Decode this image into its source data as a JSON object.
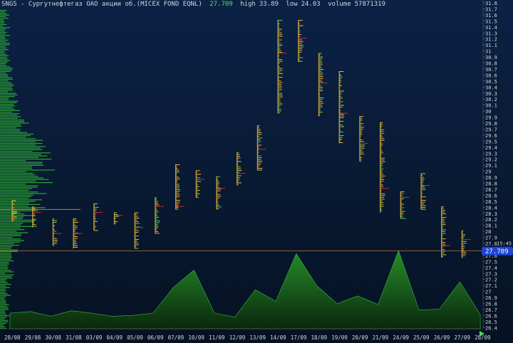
{
  "header": {
    "instrument": "SNGS - Сургутнефтегаз ОАО акции об.(MICEX FOND EQNL)",
    "last": "27.709",
    "high_label": "high",
    "high": "33.89",
    "low_label": "low",
    "low": "24.03",
    "volume_label": "volume",
    "volume": "57871319"
  },
  "price_axis": {
    "labels": [
      "31.8",
      "31.7",
      "31.6",
      "31.5",
      "31.4",
      "31.3",
      "31.2",
      "31.1",
      "31",
      "30.9",
      "30.8",
      "30.7",
      "30.6",
      "30.5",
      "30.4",
      "30.3",
      "30.2",
      "30.1",
      "30",
      "29.9",
      "29.8",
      "29.7",
      "29.6",
      "29.5",
      "29.4",
      "29.3",
      "29.2",
      "29.1",
      "29",
      "28.9",
      "28.8",
      "28.7",
      "28.6",
      "28.5",
      "28.4",
      "28.3",
      "28.2",
      "28.1",
      "28",
      "27.9",
      "27.8",
      "27.7",
      "27.6",
      "27.5",
      "27.4",
      "27.3",
      "27.2",
      "27.1",
      "27",
      "26.9",
      "26.8",
      "26.7",
      "26.6",
      "26.5",
      "26.4"
    ],
    "current_price_tag": "27.709",
    "time_tag": "15:45"
  },
  "colors": {
    "background_top": "#0b2245",
    "background_bottom": "#061223",
    "volume_fill": "#1c7a1c",
    "profile_bar": "#2fbf2f",
    "price_line": "#d78a3a",
    "price_tag": "#1d44d8",
    "poc": "#d22626",
    "axis_text": "#d6d6d6"
  },
  "chart_data": {
    "type": "area",
    "title": "",
    "x": [
      "28/08",
      "29/08",
      "30/08",
      "31/08",
      "03/09",
      "04/09",
      "05/09",
      "06/09",
      "07/09",
      "10/09",
      "11/09",
      "12/09",
      "13/09",
      "14/09",
      "17/09",
      "18/09",
      "19/09",
      "20/09",
      "21/09",
      "24/09",
      "25/09",
      "26/09",
      "27/09",
      "28/09"
    ],
    "session_ranges": [
      {
        "date": "28/08",
        "low": 28.2,
        "high": 28.55,
        "poc": 28.4
      },
      {
        "date": "29/08",
        "low": 28.1,
        "high": 28.45,
        "poc": 28.35
      },
      {
        "date": "30/08",
        "low": 27.8,
        "high": 28.25,
        "poc": 28.0
      },
      {
        "date": "31/08",
        "low": 27.75,
        "high": 28.25,
        "poc": 28.0
      },
      {
        "date": "03/09",
        "low": 28.05,
        "high": 28.5,
        "poc": 28.35
      },
      {
        "date": "04/09",
        "low": 28.15,
        "high": 28.35,
        "poc": 28.3
      },
      {
        "date": "05/09",
        "low": 27.75,
        "high": 28.35,
        "poc": 28.1
      },
      {
        "date": "06/09",
        "low": 28.0,
        "high": 28.6,
        "poc": 28.45
      },
      {
        "date": "07/09",
        "low": 28.4,
        "high": 29.15,
        "poc": 28.45
      },
      {
        "date": "10/09",
        "low": 28.6,
        "high": 29.05,
        "poc": 28.9
      },
      {
        "date": "11/09",
        "low": 28.4,
        "high": 28.95,
        "poc": 28.75
      },
      {
        "date": "12/09",
        "low": 28.8,
        "high": 29.35,
        "poc": 29.0
      },
      {
        "date": "13/09",
        "low": 29.05,
        "high": 29.8,
        "poc": 29.4
      },
      {
        "date": "14/09",
        "low": 30.0,
        "high": 31.55,
        "poc": 31.0
      },
      {
        "date": "17/09",
        "low": 30.85,
        "high": 31.55,
        "poc": 31.25
      },
      {
        "date": "18/09",
        "low": 29.95,
        "high": 31.0,
        "poc": 30.5
      },
      {
        "date": "19/09",
        "low": 29.5,
        "high": 30.7,
        "poc": 30.0
      },
      {
        "date": "20/09",
        "low": 29.2,
        "high": 29.95,
        "poc": 29.5
      },
      {
        "date": "21/09",
        "low": 28.35,
        "high": 29.85,
        "poc": 28.75
      },
      {
        "date": "24/09",
        "low": 28.25,
        "high": 28.7,
        "poc": 28.6
      },
      {
        "date": "25/09",
        "low": 28.4,
        "high": 29.0,
        "poc": 28.8
      },
      {
        "date": "26/09",
        "low": 27.6,
        "high": 28.45,
        "poc": 27.8
      },
      {
        "date": "27/09",
        "low": 27.6,
        "high": 28.05,
        "poc": 27.9
      }
    ],
    "volume_relative": [
      0.2,
      0.22,
      0.16,
      0.23,
      0.2,
      0.16,
      0.17,
      0.2,
      0.53,
      0.75,
      0.2,
      0.15,
      0.5,
      0.35,
      0.96,
      0.55,
      0.32,
      0.42,
      0.31,
      1.0,
      0.24,
      0.25,
      0.6,
      0.18
    ],
    "ylim": [
      26.4,
      31.8
    ],
    "current_price": 27.709,
    "volume_by_price_histogram": true,
    "grid": false
  }
}
